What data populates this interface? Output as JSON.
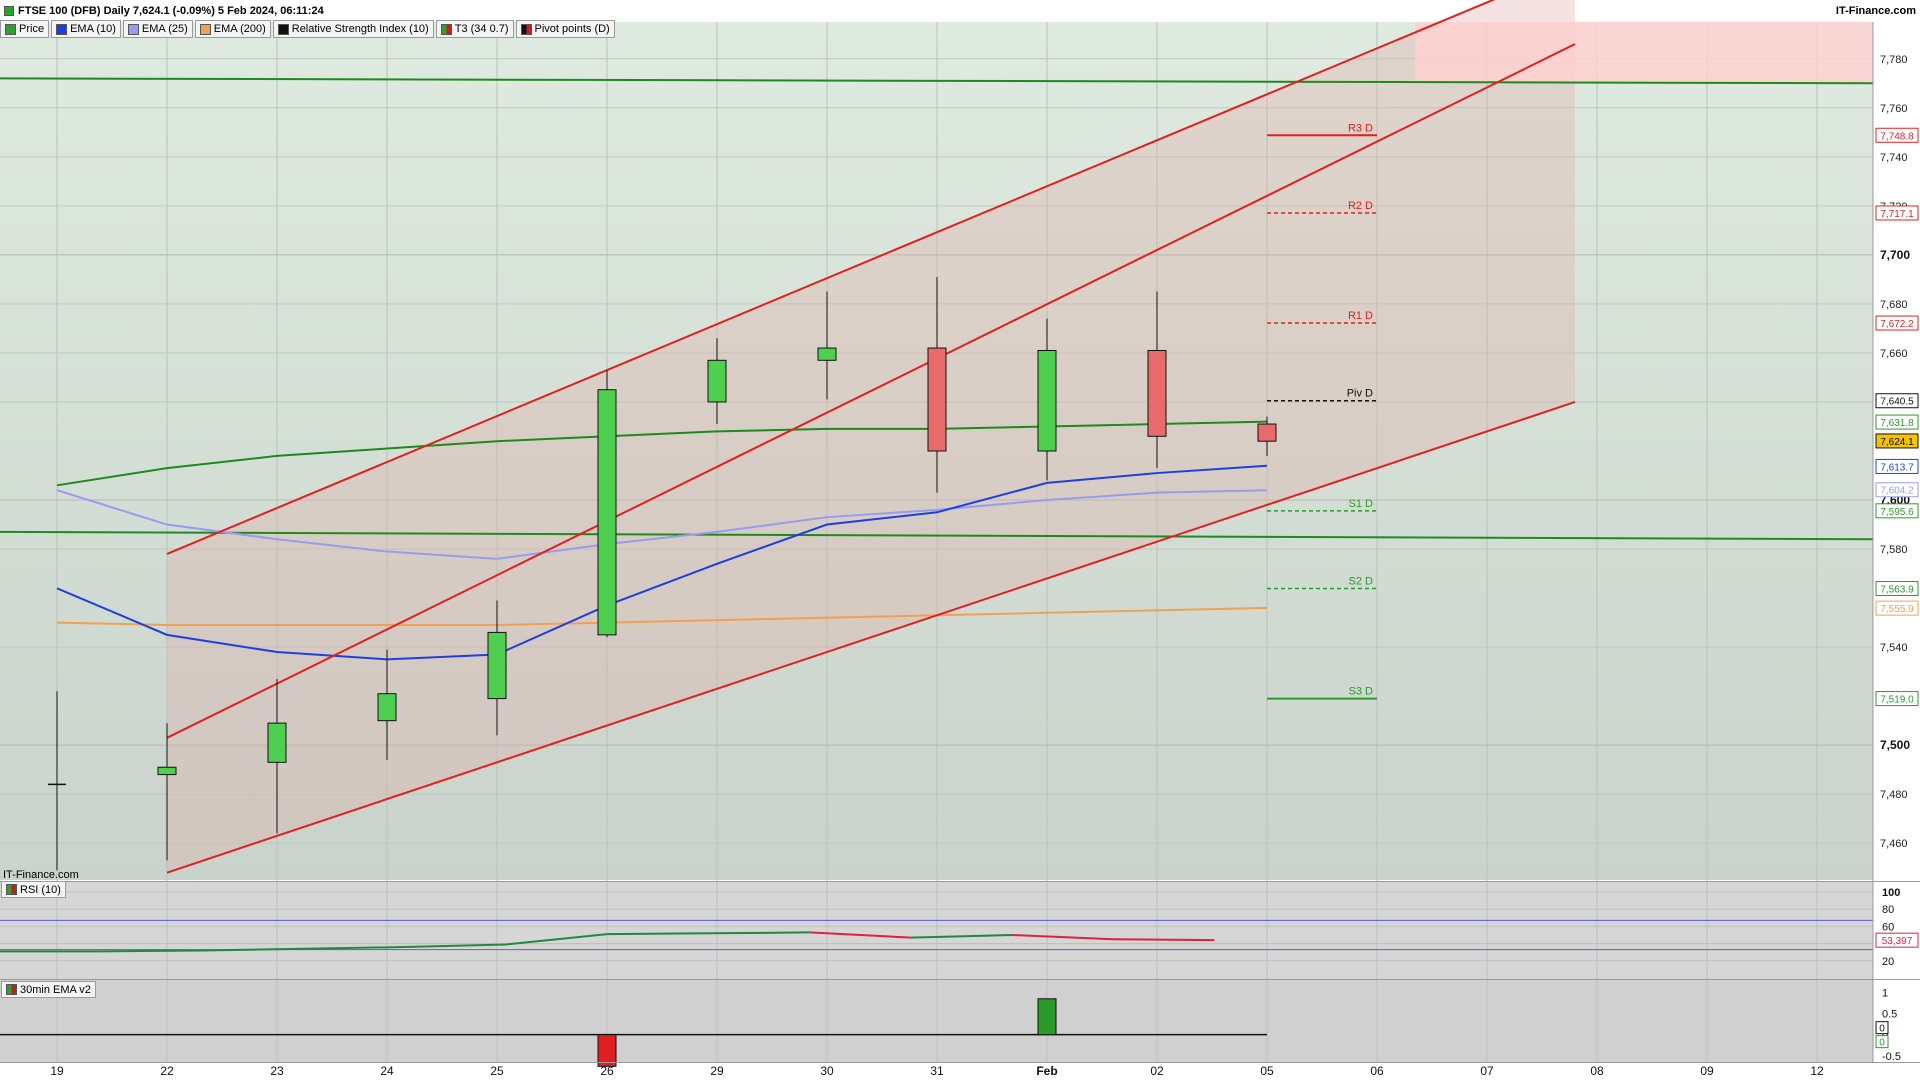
{
  "header": {
    "title": "FTSE 100 (DFB) Daily 7,624.1 (-0.09%) 5 Feb 2024, 06:11:24",
    "brand": "IT-Finance.com",
    "watermark": "IT-Finance.com"
  },
  "legend": [
    {
      "label": "Price",
      "color": "#2ea02e"
    },
    {
      "label": "EMA (10)",
      "color": "#1f3fdc"
    },
    {
      "label": "EMA (25)",
      "color": "#9a9af0"
    },
    {
      "label": "EMA (200)",
      "color": "#f0a050"
    },
    {
      "label": "Relative Strength Index (10)",
      "color": "#111111"
    },
    {
      "label": "T3 (34 0.7)",
      "color": "#c02020"
    },
    {
      "label": "Pivot points (D)",
      "color": "#111111"
    }
  ],
  "panels": {
    "rsi_label": "RSI (10)",
    "ema30_label": "30min EMA v2"
  },
  "chart_data": {
    "type": "candlestick",
    "x_labels": [
      "19",
      "22",
      "23",
      "24",
      "25",
      "26",
      "29",
      "30",
      "31",
      "Feb",
      "02",
      "05",
      "06",
      "07",
      "08",
      "09",
      "12"
    ],
    "ylim": [
      7445,
      7795
    ],
    "y_ticks_major": [
      "7,500",
      "7,600",
      "7,700"
    ],
    "y_ticks_minor": [
      "7,460",
      "7,480",
      "7,540",
      "7,580",
      "7,640",
      "7,660",
      "7,680",
      "7,720",
      "7,740",
      "7,760",
      "7,780"
    ],
    "candles": [
      {
        "x": "19",
        "open": 7484,
        "high": 7522,
        "low": 7449,
        "close": 7484
      },
      {
        "x": "22",
        "open": 7488,
        "high": 7509,
        "low": 7453,
        "close": 7491
      },
      {
        "x": "23",
        "open": 7493,
        "high": 7527,
        "low": 7464,
        "close": 7509
      },
      {
        "x": "24",
        "open": 7510,
        "high": 7539,
        "low": 7494,
        "close": 7521
      },
      {
        "x": "25",
        "open": 7519,
        "high": 7559,
        "low": 7504,
        "close": 7546
      },
      {
        "x": "26",
        "open": 7545,
        "high": 7653,
        "low": 7544,
        "close": 7645
      },
      {
        "x": "29",
        "open": 7640,
        "high": 7666,
        "low": 7631,
        "close": 7657
      },
      {
        "x": "30",
        "open": 7657,
        "high": 7685,
        "low": 7641,
        "close": 7662
      },
      {
        "x": "31",
        "open": 7662,
        "high": 7691,
        "low": 7603,
        "close": 7620
      },
      {
        "x": "Feb",
        "open": 7620,
        "high": 7674,
        "low": 7608,
        "close": 7661
      },
      {
        "x": "02",
        "open": 7661,
        "high": 7685,
        "low": 7613,
        "close": 7626
      },
      {
        "x": "05",
        "open": 7631,
        "high": 7634,
        "low": 7618,
        "close": 7624
      }
    ],
    "ema10": [
      7564,
      7545,
      7538,
      7535,
      7537,
      7557,
      7574,
      7590,
      7595,
      7607,
      7611,
      7614
    ],
    "ema25": [
      7604,
      7590,
      7584,
      7579,
      7576,
      7582,
      7587,
      7593,
      7596,
      7600,
      7603,
      7604
    ],
    "ema200": [
      7550,
      7549,
      7549,
      7549,
      7549,
      7550,
      7551,
      7552,
      7553,
      7554,
      7555,
      7556
    ],
    "t3_channel": {
      "upper": [
        [
          1,
          7578
        ],
        [
          13.8,
          7818
        ]
      ],
      "middle": [
        [
          1,
          7503
        ],
        [
          13.8,
          7786
        ]
      ],
      "lower": [
        [
          1,
          7448
        ],
        [
          13.8,
          7640
        ]
      ]
    },
    "horizontal_lines": [
      {
        "name": "upper",
        "from": 7772,
        "to": 7770
      },
      {
        "name": "lower",
        "from": 7587,
        "to": 7584
      }
    ],
    "t3_curve": [
      7606,
      7613,
      7618,
      7621,
      7624,
      7626,
      7628,
      7629,
      7629,
      7630,
      7631,
      7632
    ],
    "pivots": [
      {
        "label": "R3 D",
        "value": 7748.8,
        "color": "#e02020"
      },
      {
        "label": "R2 D",
        "value": 7717.1,
        "color": "#e02020"
      },
      {
        "label": "R1 D",
        "value": 7672.2,
        "color": "#e02020"
      },
      {
        "label": "Piv D",
        "value": 7640.5,
        "color": "#111111"
      },
      {
        "label": "S1 D",
        "value": 7595.6,
        "color": "#2a9a2a"
      },
      {
        "label": "S2 D",
        "value": 7563.9,
        "color": "#2a9a2a"
      },
      {
        "label": "S3 D",
        "value": 7519.0,
        "color": "#2a9a2a"
      }
    ],
    "price_tags": [
      {
        "text": "7,748.8",
        "value": 7748.8,
        "color": "#e02020"
      },
      {
        "text": "7,717.1",
        "value": 7717.1,
        "color": "#e02020"
      },
      {
        "text": "7,672.2",
        "value": 7672.2,
        "color": "#e02020"
      },
      {
        "text": "7,640.5",
        "value": 7640.5,
        "color": "#111111"
      },
      {
        "text": "7,631.8",
        "value": 7631.8,
        "color": "#2a9a2a"
      },
      {
        "text": "7,624.1",
        "value": 7624.1,
        "color": "#111111",
        "fill": "#f5c400"
      },
      {
        "text": "7,613.7",
        "value": 7613.7,
        "color": "#1f3fdc"
      },
      {
        "text": "7,604.2",
        "value": 7604.2,
        "color": "#9a9af0"
      },
      {
        "text": "7,595.6",
        "value": 7595.6,
        "color": "#2a9a2a"
      },
      {
        "text": "7,563.9",
        "value": 7563.9,
        "color": "#2a9a2a"
      },
      {
        "text": "7,555.9",
        "value": 7555.9,
        "color": "#f0a050"
      },
      {
        "text": "7,519.0",
        "value": 7519.0,
        "color": "#2a9a2a"
      }
    ],
    "rsi": {
      "ylim": [
        0,
        100
      ],
      "ticks": [
        "100",
        "80",
        "60",
        "40",
        "20"
      ],
      "bands": [
        67,
        33
      ],
      "values": [
        31,
        31,
        32,
        34,
        36,
        39,
        51,
        52,
        53,
        47,
        50,
        45,
        44
      ],
      "last_tag": "53,397"
    },
    "ema30": {
      "ylim": [
        -0.6,
        1.2
      ],
      "ticks": [
        "1",
        "0.5",
        "0",
        "-0.5"
      ],
      "bars": [
        {
          "x": "26",
          "value": -1
        },
        {
          "x": "Feb",
          "value": 1
        }
      ],
      "tags": [
        "0",
        "0"
      ]
    }
  }
}
